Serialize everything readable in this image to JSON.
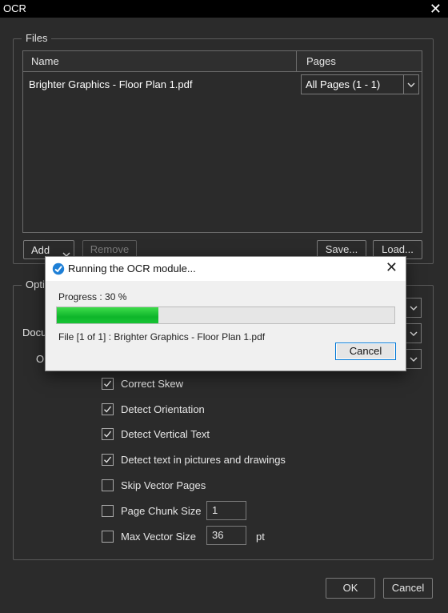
{
  "window": {
    "title": "OCR"
  },
  "files_group": {
    "legend": "Files",
    "columns": {
      "name": "Name",
      "pages": "Pages"
    },
    "rows": [
      {
        "name": "Brighter Graphics - Floor Plan 1.pdf",
        "pages": "All Pages (1 - 1)"
      }
    ],
    "buttons": {
      "add": "Add",
      "remove": "Remove",
      "save": "Save...",
      "load": "Load..."
    }
  },
  "options_group": {
    "legend": "Opti",
    "document_label": "Docu",
    "output_label": "O",
    "checks": [
      {
        "label": "Correct Skew",
        "checked": true
      },
      {
        "label": "Detect Orientation",
        "checked": true
      },
      {
        "label": "Detect Vertical Text",
        "checked": true
      },
      {
        "label": "Detect text in pictures and drawings",
        "checked": true
      },
      {
        "label": "Skip Vector Pages",
        "checked": false
      },
      {
        "label": "Page Chunk Size",
        "checked": false
      },
      {
        "label": "Max Vector Size",
        "checked": false
      }
    ],
    "page_chunk_size": "1",
    "max_vector_size": "36",
    "max_vector_unit": "pt"
  },
  "footer": {
    "ok": "OK",
    "cancel": "Cancel"
  },
  "progress_dialog": {
    "title": "Running the OCR module...",
    "progress_text": "Progress : 30 %",
    "progress_fraction": 0.3,
    "file_text": "File [1 of 1] : Brighter Graphics - Floor Plan 1.pdf",
    "cancel": "Cancel"
  },
  "colors": {
    "background": "#2b2b2b",
    "progress_green": "#16c434",
    "focus_blue": "#0078d7"
  }
}
